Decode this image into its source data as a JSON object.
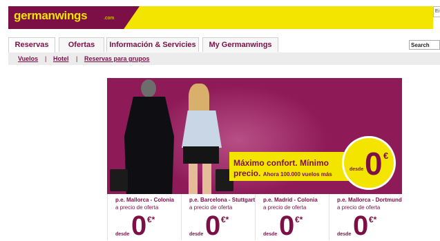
{
  "header": {
    "logo": "germanwings",
    "logo_suffix": ".com",
    "corner_badge": "Ei"
  },
  "nav": {
    "tabs": [
      {
        "label": "Reservas",
        "active": true
      },
      {
        "label": "Ofertas",
        "active": false
      },
      {
        "label": "Información & Servicies",
        "active": false
      },
      {
        "label": "My Germanwings",
        "active": false
      }
    ],
    "search_label": "Search"
  },
  "subnav": {
    "links": [
      "Vuelos",
      "Hotel",
      "Reservas para grupos"
    ],
    "separator": "|"
  },
  "banner": {
    "headline": "Máximo confort. Mínimo",
    "headline2": "precio.",
    "subline": "Ahora 100.000 vuelos más",
    "desde": "desde",
    "price": "0",
    "currency": "€",
    "asterisk": "*"
  },
  "offers": [
    {
      "route": "p.e. Mallorca - Colonia",
      "sub": "a precio de oferta",
      "desde": "desde",
      "price": "0",
      "currency": "€*"
    },
    {
      "route": "p.e. Barcelona - Stuttgart",
      "sub": "a precio de oferta",
      "desde": "desde",
      "price": "0",
      "currency": "€*"
    },
    {
      "route": "p.e. Madrid - Colonia",
      "sub": "a precio de oferta",
      "desde": "desde",
      "price": "0",
      "currency": "€*"
    },
    {
      "route": "p.e. Mallorca - Dortmund",
      "sub": "a precio de oferta",
      "desde": "desde",
      "price": "0",
      "currency": "€*"
    }
  ],
  "colors": {
    "brand_maroon": "#7b0f46",
    "brand_yellow": "#f3e500",
    "banner_bg": "#8e1b58"
  }
}
